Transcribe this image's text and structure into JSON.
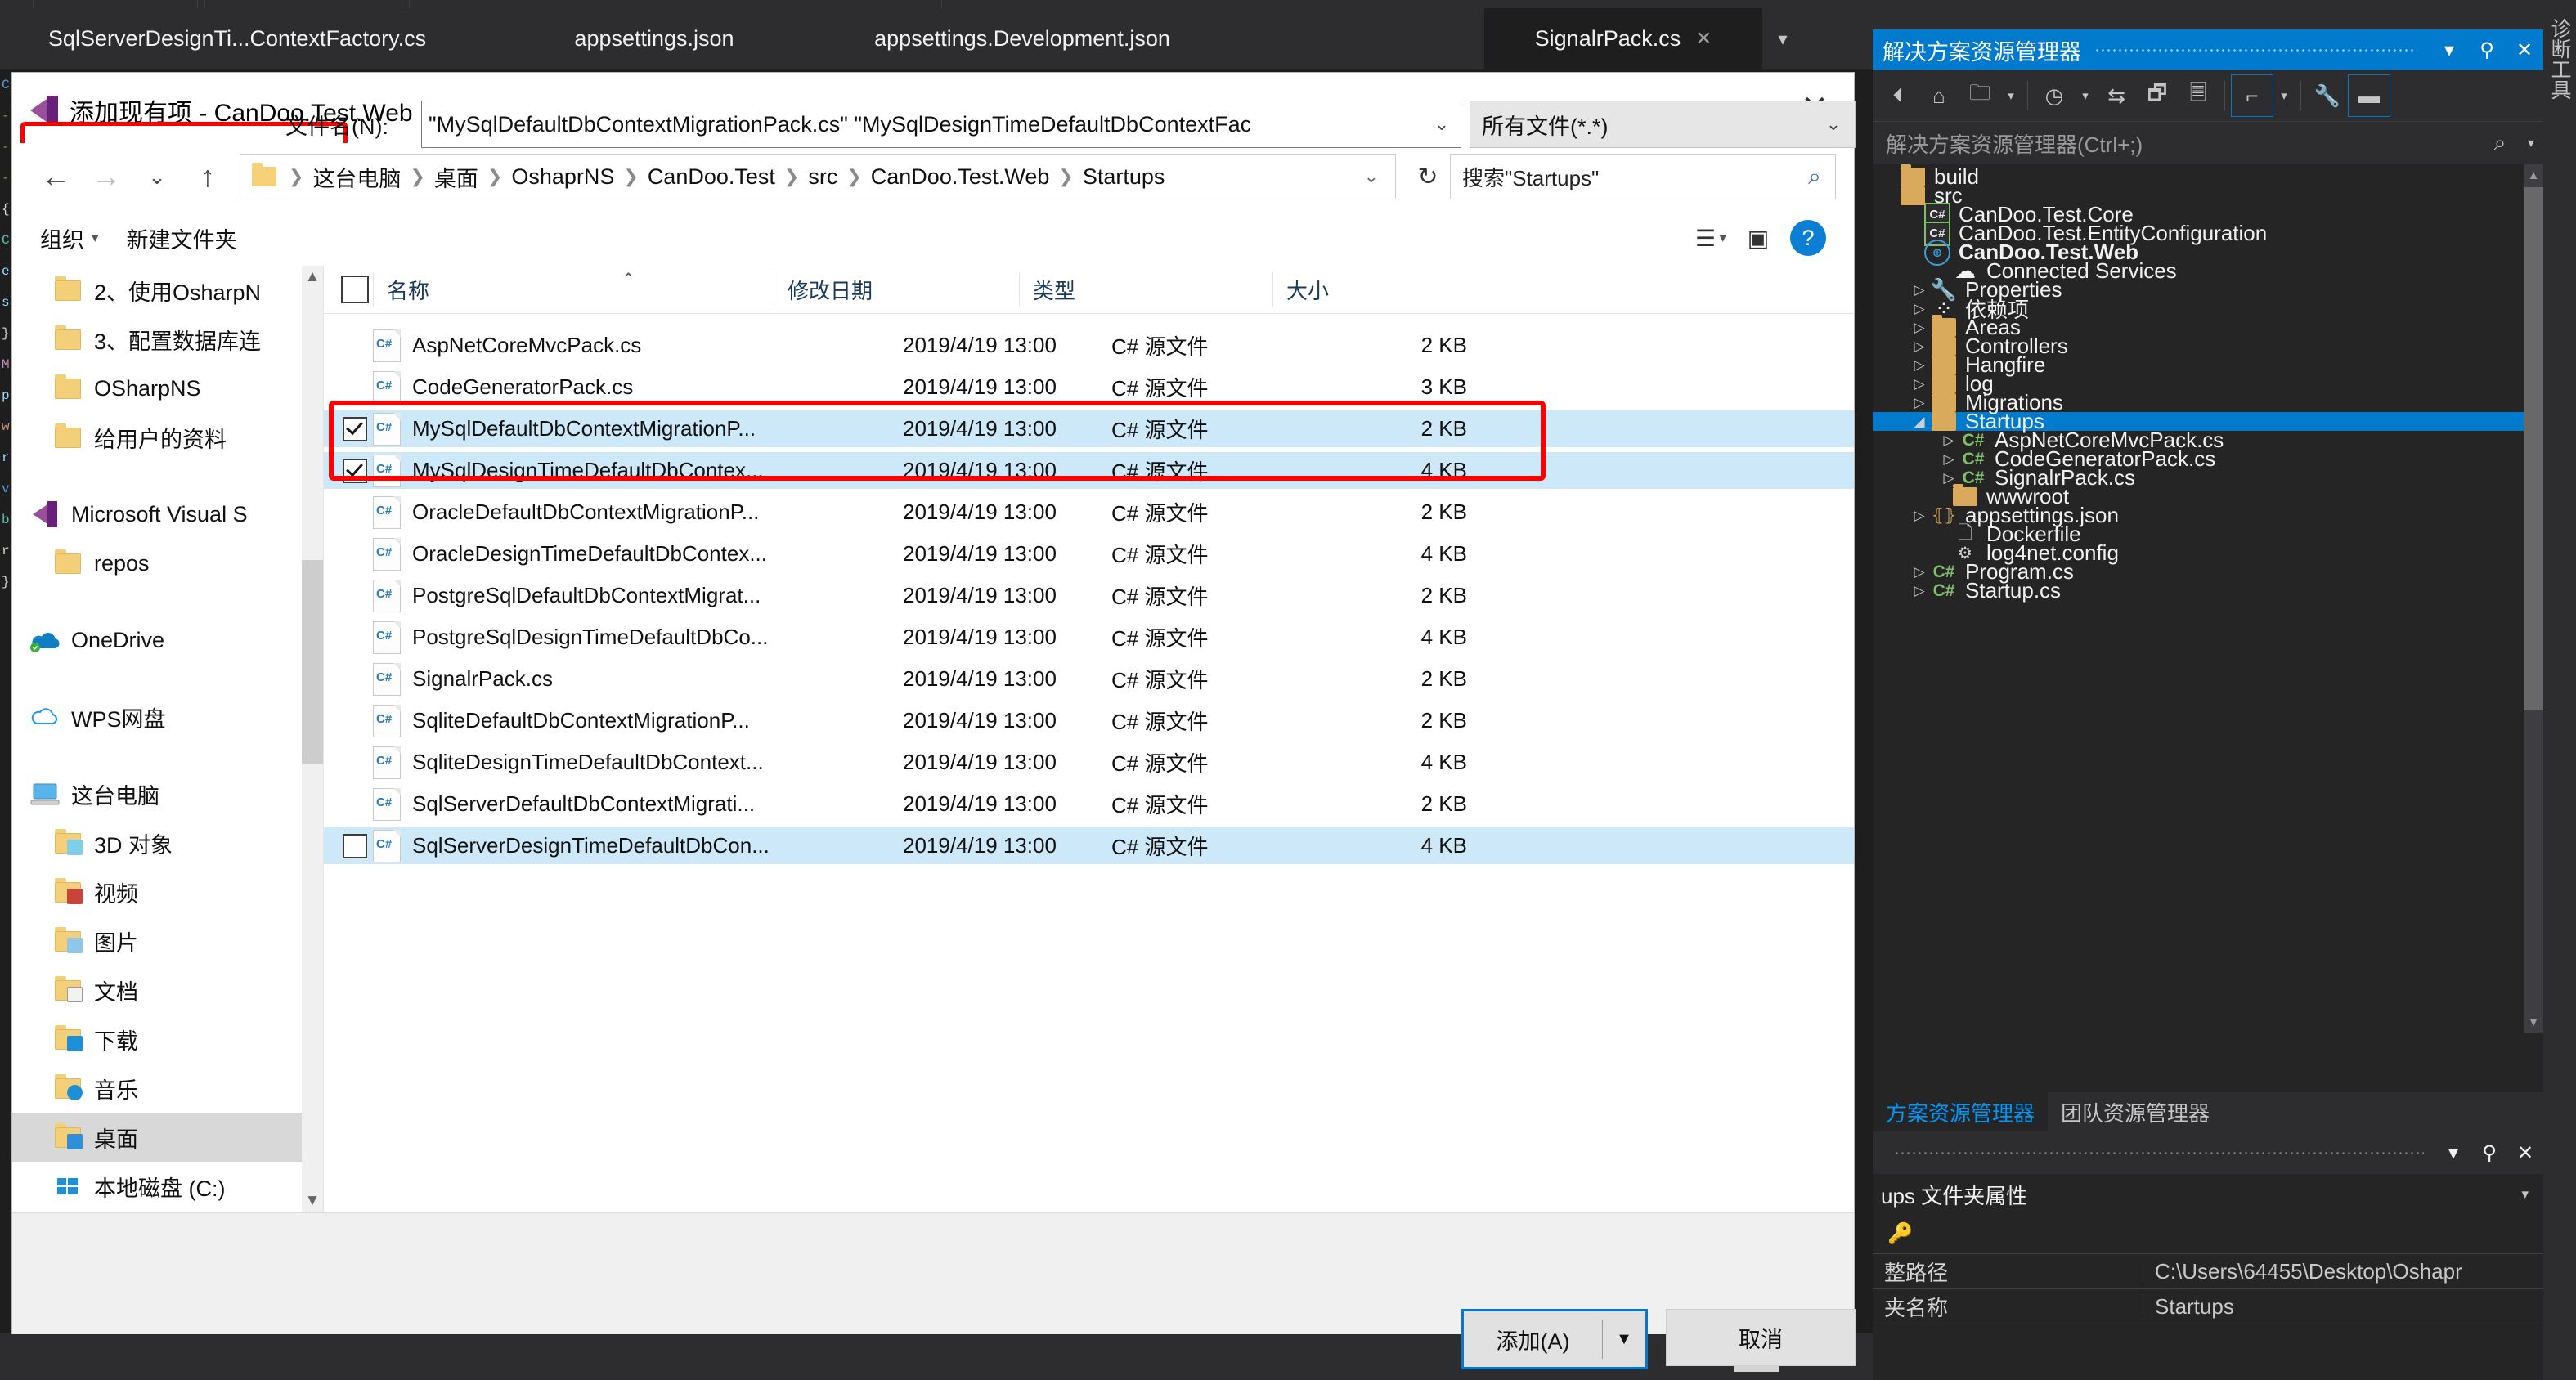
{
  "ide": {
    "tabs": [
      {
        "label": "SqlServerDesignTi...ContextFactory.cs",
        "active": false
      },
      {
        "label": "appsettings.json",
        "active": false
      },
      {
        "label": "appsettings.Development.json",
        "active": false
      },
      {
        "label": "SignalrPack.cs",
        "active": true
      }
    ],
    "code_sliver": [
      "C",
      "-",
      "-",
      "-",
      "{",
      "C",
      "e",
      "s",
      "}",
      "M",
      "p",
      "w",
      "r",
      "v",
      "b",
      "r",
      "}"
    ]
  },
  "dialog": {
    "title": "添加现有项 - CanDoo.Test.Web",
    "close_label": "✕",
    "nav": {
      "back": "←",
      "forward": "→",
      "recent": "⌄",
      "up": "↑",
      "refresh": "↻",
      "breadcrumb": [
        "这台电脑",
        "桌面",
        "OshaprNS",
        "CanDoo.Test",
        "src",
        "CanDoo.Test.Web",
        "Startups"
      ],
      "breadcrumb_caret": "⌄",
      "search_value": "搜索\"Startups\"",
      "search_icon": "⌕"
    },
    "toolbar": {
      "organize": "组织",
      "organize_caret": "▾",
      "new_folder": "新建文件夹",
      "view_icon": "☰",
      "view_caret": "▾",
      "pane_icon": "▣",
      "help_icon": "?"
    },
    "places": [
      {
        "label": "2、使用OsharpN",
        "icon": "folder-icon",
        "indent": true,
        "selected": false
      },
      {
        "label": "3、配置数据库连",
        "icon": "folder-icon",
        "indent": true,
        "selected": false
      },
      {
        "label": "OSharpNS",
        "icon": "folder-icon",
        "indent": true,
        "selected": false
      },
      {
        "label": "给用户的资料",
        "icon": "folder-icon",
        "indent": true,
        "selected": false
      },
      {
        "label": "",
        "icon": "spacer",
        "indent": false,
        "selected": false
      },
      {
        "label": "Microsoft Visual S",
        "icon": "visual-studio-icon",
        "indent": false,
        "selected": false
      },
      {
        "label": "repos",
        "icon": "folder-icon",
        "indent": true,
        "selected": false
      },
      {
        "label": "",
        "icon": "spacer",
        "indent": false,
        "selected": false
      },
      {
        "label": "OneDrive",
        "icon": "onedrive-icon",
        "indent": false,
        "selected": false
      },
      {
        "label": "",
        "icon": "spacer",
        "indent": false,
        "selected": false
      },
      {
        "label": "WPS网盘",
        "icon": "wps-cloud-icon",
        "indent": false,
        "selected": false
      },
      {
        "label": "",
        "icon": "spacer",
        "indent": false,
        "selected": false
      },
      {
        "label": "这台电脑",
        "icon": "this-pc-icon",
        "indent": false,
        "selected": false
      },
      {
        "label": "3D 对象",
        "icon": "folder-3d-icon",
        "indent": true,
        "selected": false
      },
      {
        "label": "视频",
        "icon": "folder-video-icon",
        "indent": true,
        "selected": false
      },
      {
        "label": "图片",
        "icon": "folder-pictures-icon",
        "indent": true,
        "selected": false
      },
      {
        "label": "文档",
        "icon": "folder-documents-icon",
        "indent": true,
        "selected": false
      },
      {
        "label": "下载",
        "icon": "folder-downloads-icon",
        "indent": true,
        "selected": false
      },
      {
        "label": "音乐",
        "icon": "folder-music-icon",
        "indent": true,
        "selected": false
      },
      {
        "label": "桌面",
        "icon": "folder-desktop-icon",
        "indent": true,
        "selected": true
      },
      {
        "label": "本地磁盘 (C:)",
        "icon": "local-disk-icon",
        "indent": true,
        "selected": false
      }
    ],
    "columns": [
      "名称",
      "修改日期",
      "类型",
      "大小"
    ],
    "files": [
      {
        "name": "AspNetCoreMvcPack.cs",
        "date": "2019/4/19 13:00",
        "type": "C# 源文件",
        "size": "2 KB",
        "checked": false,
        "selected": false,
        "show_check": false
      },
      {
        "name": "CodeGeneratorPack.cs",
        "date": "2019/4/19 13:00",
        "type": "C# 源文件",
        "size": "3 KB",
        "checked": false,
        "selected": false,
        "show_check": false
      },
      {
        "name": "MySqlDefaultDbContextMigrationP...",
        "date": "2019/4/19 13:00",
        "type": "C# 源文件",
        "size": "2 KB",
        "checked": true,
        "selected": true,
        "show_check": true
      },
      {
        "name": "MySqlDesignTimeDefaultDbContex...",
        "date": "2019/4/19 13:00",
        "type": "C# 源文件",
        "size": "4 KB",
        "checked": true,
        "selected": true,
        "show_check": true
      },
      {
        "name": "OracleDefaultDbContextMigrationP...",
        "date": "2019/4/19 13:00",
        "type": "C# 源文件",
        "size": "2 KB",
        "checked": false,
        "selected": false,
        "show_check": false
      },
      {
        "name": "OracleDesignTimeDefaultDbContex...",
        "date": "2019/4/19 13:00",
        "type": "C# 源文件",
        "size": "4 KB",
        "checked": false,
        "selected": false,
        "show_check": false
      },
      {
        "name": "PostgreSqlDefaultDbContextMigrat...",
        "date": "2019/4/19 13:00",
        "type": "C# 源文件",
        "size": "2 KB",
        "checked": false,
        "selected": false,
        "show_check": false
      },
      {
        "name": "PostgreSqlDesignTimeDefaultDbCo...",
        "date": "2019/4/19 13:00",
        "type": "C# 源文件",
        "size": "4 KB",
        "checked": false,
        "selected": false,
        "show_check": false
      },
      {
        "name": "SignalrPack.cs",
        "date": "2019/4/19 13:00",
        "type": "C# 源文件",
        "size": "2 KB",
        "checked": false,
        "selected": false,
        "show_check": false
      },
      {
        "name": "SqliteDefaultDbContextMigrationP...",
        "date": "2019/4/19 13:00",
        "type": "C# 源文件",
        "size": "2 KB",
        "checked": false,
        "selected": false,
        "show_check": false
      },
      {
        "name": "SqliteDesignTimeDefaultDbContext...",
        "date": "2019/4/19 13:00",
        "type": "C# 源文件",
        "size": "4 KB",
        "checked": false,
        "selected": false,
        "show_check": false
      },
      {
        "name": "SqlServerDefaultDbContextMigrati...",
        "date": "2019/4/19 13:00",
        "type": "C# 源文件",
        "size": "2 KB",
        "checked": false,
        "selected": false,
        "show_check": false
      },
      {
        "name": "SqlServerDesignTimeDefaultDbCon...",
        "date": "2019/4/19 13:00",
        "type": "C# 源文件",
        "size": "4 KB",
        "checked": false,
        "selected": true,
        "show_check": true
      }
    ],
    "footer": {
      "filename_label": "文件名(N):",
      "filename_value": "\"MySqlDefaultDbContextMigrationPack.cs\" \"MySqlDesignTimeDefaultDbContextFac",
      "filename_caret": "⌄",
      "filter_value": "所有文件(*.*)",
      "filter_caret": "⌄",
      "add_button": "添加(A)",
      "add_caret": "▼",
      "cancel_button": "取消"
    }
  },
  "solution_explorer": {
    "title": "解决方案资源管理器",
    "window_buttons": [
      "▾",
      "⚲",
      "✕"
    ],
    "search_placeholder": "解决方案资源管理器(Ctrl+;)",
    "search_icon": "⌕",
    "search_caret": "▾",
    "toolbar_icons": [
      "back-icon",
      "home-icon",
      "new-folder-view-icon",
      "pending-changes-icon",
      "sync-icon",
      "collapse-all-icon",
      "show-all-files-icon",
      "preview-selected-items-icon",
      "properties-icon",
      "hide-solution-icon"
    ],
    "tree": [
      {
        "label": "build",
        "icon": "folder-icon",
        "depth": 0,
        "arrow": "",
        "selected": false,
        "bold": false
      },
      {
        "label": "src",
        "icon": "folder-open-icon",
        "depth": 0,
        "arrow": "",
        "selected": false,
        "bold": false
      },
      {
        "label": "CanDoo.Test.Core",
        "icon": "csharp-project-icon",
        "depth": 1,
        "arrow": "",
        "selected": false,
        "bold": false
      },
      {
        "label": "CanDoo.Test.EntityConfiguration",
        "icon": "csharp-project-icon",
        "depth": 1,
        "arrow": "",
        "selected": false,
        "bold": false
      },
      {
        "label": "CanDoo.Test.Web",
        "icon": "web-project-icon",
        "depth": 1,
        "arrow": "",
        "selected": false,
        "bold": true
      },
      {
        "label": "Connected Services",
        "icon": "connected-services-icon",
        "depth": 2,
        "arrow": "",
        "selected": false,
        "bold": false
      },
      {
        "label": "Properties",
        "icon": "wrench-icon",
        "depth": 2,
        "arrow": "▷",
        "selected": false,
        "bold": false
      },
      {
        "label": "依赖项",
        "icon": "dependencies-icon",
        "depth": 2,
        "arrow": "▷",
        "selected": false,
        "bold": false
      },
      {
        "label": "Areas",
        "icon": "folder-icon",
        "depth": 2,
        "arrow": "▷",
        "selected": false,
        "bold": false
      },
      {
        "label": "Controllers",
        "icon": "folder-icon",
        "depth": 2,
        "arrow": "▷",
        "selected": false,
        "bold": false
      },
      {
        "label": "Hangfire",
        "icon": "folder-icon",
        "depth": 2,
        "arrow": "▷",
        "selected": false,
        "bold": false
      },
      {
        "label": "log",
        "icon": "folder-icon",
        "depth": 2,
        "arrow": "▷",
        "selected": false,
        "bold": false
      },
      {
        "label": "Migrations",
        "icon": "folder-icon",
        "depth": 2,
        "arrow": "▷",
        "selected": false,
        "bold": false
      },
      {
        "label": "Startups",
        "icon": "folder-open-icon",
        "depth": 2,
        "arrow": "◢",
        "selected": true,
        "bold": false
      },
      {
        "label": "AspNetCoreMvcPack.cs",
        "icon": "csharp-file-icon",
        "depth": 3,
        "arrow": "▷",
        "selected": false,
        "bold": false
      },
      {
        "label": "CodeGeneratorPack.cs",
        "icon": "csharp-file-icon",
        "depth": 3,
        "arrow": "▷",
        "selected": false,
        "bold": false
      },
      {
        "label": "SignalrPack.cs",
        "icon": "csharp-file-icon",
        "depth": 3,
        "arrow": "▷",
        "selected": false,
        "bold": false
      },
      {
        "label": "wwwroot",
        "icon": "folder-excluded-icon",
        "depth": 2,
        "arrow": "",
        "selected": false,
        "bold": false
      },
      {
        "label": "appsettings.json",
        "icon": "json-file-icon",
        "depth": 2,
        "arrow": "▷",
        "selected": false,
        "bold": false
      },
      {
        "label": "Dockerfile",
        "icon": "file-icon",
        "depth": 2,
        "arrow": "",
        "selected": false,
        "bold": false
      },
      {
        "label": "log4net.config",
        "icon": "config-file-icon",
        "depth": 2,
        "arrow": "",
        "selected": false,
        "bold": false
      },
      {
        "label": "Program.cs",
        "icon": "csharp-file-icon",
        "depth": 2,
        "arrow": "▷",
        "selected": false,
        "bold": false
      },
      {
        "label": "Startup.cs",
        "icon": "csharp-file-icon",
        "depth": 2,
        "arrow": "▷",
        "selected": false,
        "bold": false
      }
    ],
    "tabs": [
      {
        "label": "方案资源管理器",
        "active": true
      },
      {
        "label": "团队资源管理器",
        "active": false
      }
    ]
  },
  "properties_panel": {
    "window_buttons": [
      "▾",
      "⚲",
      "✕"
    ],
    "object_label": "ups 文件夹属性",
    "object_caret": "▾",
    "toolbar_icons": [
      "properties-key-icon"
    ],
    "rows": [
      {
        "key": "整路径",
        "value": "C:\\Users\\64455\\Desktop\\Oshapr"
      },
      {
        "key": "夹名称",
        "value": "Startups"
      }
    ]
  },
  "vertical_rail": {
    "label": "诊断工具"
  }
}
